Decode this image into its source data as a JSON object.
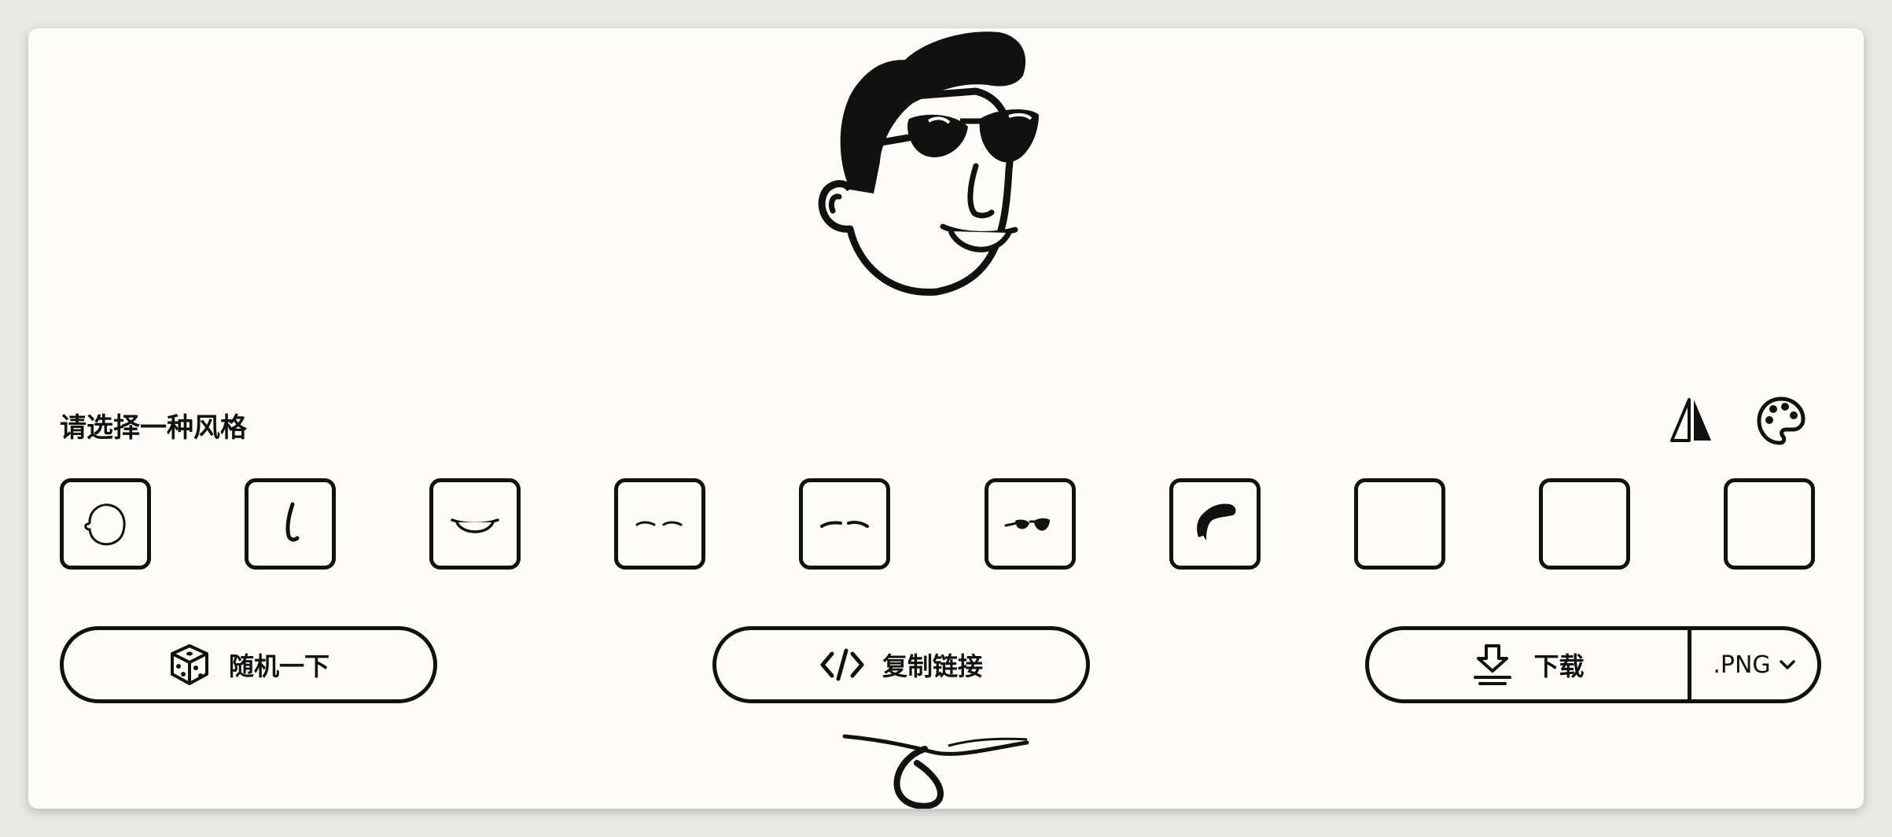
{
  "section": {
    "title": "请选择一种风格"
  },
  "tools": {
    "flip_icon": "flip-horizontal-icon",
    "palette_icon": "palette-icon"
  },
  "parts": [
    {
      "name": "face",
      "icon": "face-shape-icon"
    },
    {
      "name": "nose",
      "icon": "nose-icon"
    },
    {
      "name": "mouth",
      "icon": "mouth-icon"
    },
    {
      "name": "eyes",
      "icon": "eyes-icon"
    },
    {
      "name": "eyebrows",
      "icon": "eyebrows-icon"
    },
    {
      "name": "glasses",
      "icon": "sunglasses-icon"
    },
    {
      "name": "hair",
      "icon": "hair-icon"
    },
    {
      "name": "accessory",
      "icon": ""
    },
    {
      "name": "beard",
      "icon": ""
    },
    {
      "name": "details",
      "icon": ""
    }
  ],
  "actions": {
    "random_label": "随机一下",
    "copy_label": "复制链接",
    "download_label": "下载",
    "format_label": ".PNG"
  },
  "colors": {
    "background": "#fdfcf8",
    "ink": "#111111",
    "page": "#e9e9e7"
  }
}
